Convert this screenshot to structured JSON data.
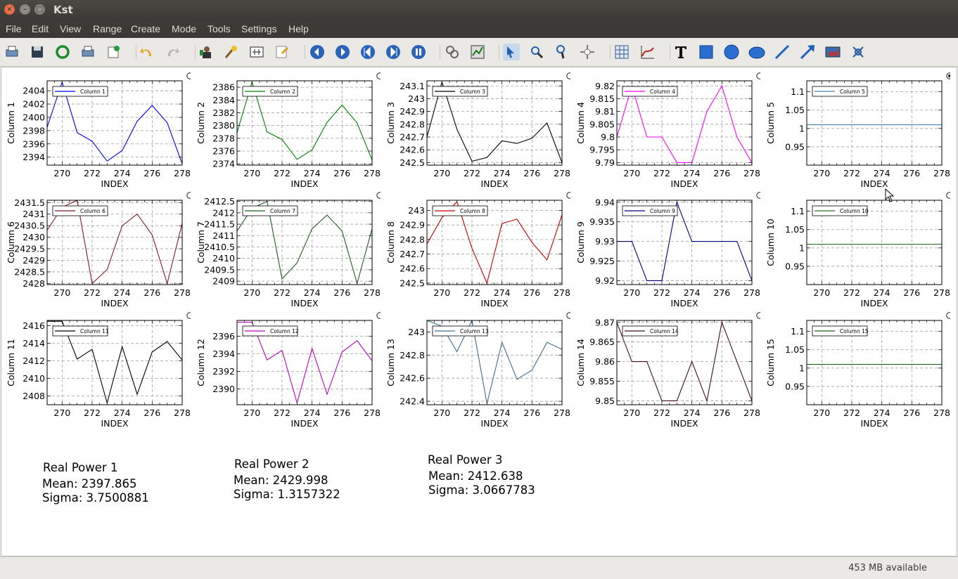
{
  "window": {
    "title": "Kst"
  },
  "menu": [
    "File",
    "Edit",
    "View",
    "Range",
    "Create",
    "Mode",
    "Tools",
    "Settings",
    "Help"
  ],
  "toolbar_icons": [
    "print-icon",
    "save-icon",
    "reload-icon",
    "print-icon",
    "log-icon",
    "undo-icon",
    "redo-icon",
    "data-manager-icon",
    "data-wizard-icon",
    "change-data-file-icon",
    "change-dialog-icon",
    "back-icon",
    "forward-icon",
    "read-from-end-icon",
    "read-to-end-icon",
    "pause-icon",
    "tied-zoom-icon",
    "zoom-xy-icon",
    "zoom-select-icon",
    "zoom-x-icon",
    "zoom-y-icon",
    "layout-icon",
    "table-icon",
    "plot-icon",
    "text-icon",
    "box-icon",
    "circle-icon",
    "ellipse-icon",
    "line-icon",
    "arrow-icon",
    "picture-icon",
    "shared-axis-icon"
  ],
  "status": {
    "memory": "453 MB available"
  },
  "chart_data": [
    {
      "type": "line",
      "ylabel": "Column 1",
      "xlabel": "INDEX",
      "legend": "Column 1",
      "color": "#0000ff",
      "xlim": [
        269,
        278
      ],
      "ylim": [
        2392.8,
        2405.5
      ],
      "yticks": [
        2394,
        2396,
        2398,
        2400,
        2402,
        2404
      ],
      "ytickLabels": [
        "2394",
        "2396",
        "2398",
        "2400",
        "2402",
        "2404"
      ],
      "x": [
        269,
        270,
        271,
        272,
        273,
        274,
        275,
        276,
        277,
        278
      ],
      "y": [
        2398.5,
        2405.3,
        2397.7,
        2396.4,
        2393.4,
        2395.0,
        2399.4,
        2401.8,
        2399.2,
        2393.0
      ]
    },
    {
      "type": "line",
      "ylabel": "Column 2",
      "xlabel": "INDEX",
      "legend": "Column 2",
      "color": "#007f00",
      "xlim": [
        269,
        278
      ],
      "ylim": [
        2373.8,
        2387.0
      ],
      "yticks": [
        2374,
        2376,
        2378,
        2380,
        2382,
        2384,
        2386
      ],
      "ytickLabels": [
        "2374",
        "2376",
        "2378",
        "2380",
        "2382",
        "2384",
        "2386"
      ],
      "x": [
        269,
        270,
        271,
        272,
        273,
        274,
        275,
        276,
        277,
        278
      ],
      "y": [
        2378.9,
        2386.8,
        2379.0,
        2377.8,
        2374.7,
        2376.2,
        2380.5,
        2383.2,
        2380.4,
        2374.6
      ]
    },
    {
      "type": "line",
      "ylabel": "Column 3",
      "xlabel": "INDEX",
      "legend": "Column 3",
      "color": "#000000",
      "xlim": [
        269,
        278
      ],
      "ylim": [
        242.48,
        243.14
      ],
      "yticks": [
        242.5,
        242.6,
        242.7,
        242.8,
        242.9,
        243.0,
        243.1
      ],
      "ytickLabels": [
        "242.5",
        "242.6",
        "242.7",
        "242.8",
        "242.9",
        "243",
        "243.1"
      ],
      "x": [
        269,
        270,
        271,
        272,
        273,
        274,
        275,
        276,
        277,
        278
      ],
      "y": [
        242.7,
        243.13,
        242.76,
        242.51,
        242.54,
        242.67,
        242.65,
        242.69,
        242.81,
        242.5
      ]
    },
    {
      "type": "line",
      "ylabel": "Column 4",
      "xlabel": "INDEX",
      "legend": "Column 4",
      "color": "#ff00ff",
      "xlim": [
        269,
        278
      ],
      "ylim": [
        9.789,
        9.822
      ],
      "yticks": [
        9.79,
        9.795,
        9.8,
        9.805,
        9.81,
        9.815,
        9.82
      ],
      "ytickLabels": [
        "9.79",
        "9.795",
        "9.8",
        "9.805",
        "9.81",
        "9.815",
        "9.82"
      ],
      "x": [
        269,
        270,
        271,
        272,
        273,
        274,
        275,
        276,
        277,
        278
      ],
      "y": [
        9.8,
        9.82,
        9.8,
        9.8,
        9.79,
        9.79,
        9.81,
        9.82,
        9.8,
        9.79
      ]
    },
    {
      "type": "line",
      "ylabel": "Column 5",
      "xlabel": "INDEX",
      "legend": "Column 5",
      "color": "#4682b4",
      "xlim": [
        269,
        278
      ],
      "ylim": [
        0.9,
        1.13
      ],
      "yticks": [
        0.95,
        1.0,
        1.05,
        1.1
      ],
      "ytickLabels": [
        "0.95",
        "1",
        "1.05",
        "1.1"
      ],
      "x": [
        269,
        278
      ],
      "y": [
        1.01,
        1.01
      ]
    },
    {
      "type": "line",
      "ylabel": "Column 6",
      "xlabel": "INDEX",
      "legend": "Column 6",
      "color": "#7f1f1f",
      "xlim": [
        269,
        278
      ],
      "ylim": [
        2427.95,
        2431.6
      ],
      "yticks": [
        2428,
        2428.5,
        2429,
        2429.5,
        2430,
        2430.5,
        2431,
        2431.5
      ],
      "ytickLabels": [
        "2428",
        "2428.5",
        "2429",
        "2429.5",
        "2430",
        "2430.5",
        "2431",
        "2431.5"
      ],
      "x": [
        269,
        270,
        271,
        272,
        273,
        274,
        275,
        276,
        277,
        278
      ],
      "y": [
        2430.3,
        2431.3,
        2431.6,
        2428.0,
        2428.6,
        2430.5,
        2431.0,
        2430.1,
        2428.0,
        2430.6
      ]
    },
    {
      "type": "line",
      "ylabel": "Column 7",
      "xlabel": "INDEX",
      "legend": "Column 7",
      "color": "#1f5f1f",
      "xlim": [
        269,
        278
      ],
      "ylim": [
        2408.85,
        2412.55
      ],
      "yticks": [
        2409,
        2409.5,
        2410,
        2410.5,
        2411,
        2411.5,
        2412,
        2412.5
      ],
      "ytickLabels": [
        "2409",
        "2409.5",
        "2410",
        "2410.5",
        "2411",
        "2411.5",
        "2412",
        "2412.5"
      ],
      "x": [
        269,
        270,
        271,
        272,
        273,
        274,
        275,
        276,
        277,
        278
      ],
      "y": [
        2411.2,
        2412.2,
        2412.5,
        2409.1,
        2409.8,
        2411.3,
        2411.9,
        2411.2,
        2408.9,
        2411.3
      ]
    },
    {
      "type": "line",
      "ylabel": "Column 8",
      "xlabel": "INDEX",
      "legend": "Column 8",
      "color": "#bf0000",
      "xlim": [
        269,
        278
      ],
      "ylim": [
        242.49,
        243.07
      ],
      "yticks": [
        242.5,
        242.6,
        242.7,
        242.8,
        242.9,
        243.0
      ],
      "ytickLabels": [
        "242.5",
        "242.6",
        "242.7",
        "242.8",
        "242.9",
        "243"
      ],
      "x": [
        269,
        270,
        271,
        272,
        273,
        274,
        275,
        276,
        277,
        278
      ],
      "y": [
        242.77,
        242.95,
        243.06,
        242.74,
        242.5,
        242.91,
        242.94,
        242.78,
        242.66,
        242.97
      ]
    },
    {
      "type": "line",
      "ylabel": "Column 9",
      "xlabel": "INDEX",
      "legend": "Column 9",
      "color": "#00007f",
      "xlim": [
        269,
        278
      ],
      "ylim": [
        9.919,
        9.9405
      ],
      "yticks": [
        9.92,
        9.925,
        9.93,
        9.935,
        9.94
      ],
      "ytickLabels": [
        "9.92",
        "9.925",
        "9.93",
        "9.935",
        "9.94"
      ],
      "x": [
        269,
        270,
        271,
        272,
        273,
        274,
        275,
        276,
        277,
        278
      ],
      "y": [
        9.93,
        9.93,
        9.92,
        9.92,
        9.94,
        9.93,
        9.93,
        9.93,
        9.93,
        9.92
      ]
    },
    {
      "type": "line",
      "ylabel": "Column 10",
      "xlabel": "INDEX",
      "legend": "Column 10",
      "color": "#2f6f2f",
      "xlim": [
        269,
        278
      ],
      "ylim": [
        0.9,
        1.13
      ],
      "yticks": [
        0.95,
        1.0,
        1.05,
        1.1
      ],
      "ytickLabels": [
        "0.95",
        "1",
        "1.05",
        "1.1"
      ],
      "x": [
        269,
        278
      ],
      "y": [
        1.01,
        1.01
      ]
    },
    {
      "type": "line",
      "ylabel": "Column 11",
      "xlabel": "INDEX",
      "legend": "Column 11",
      "color": "#000000",
      "xlim": [
        269,
        278
      ],
      "ylim": [
        2407.0,
        2416.6
      ],
      "yticks": [
        2408,
        2410,
        2412,
        2414,
        2416
      ],
      "ytickLabels": [
        "2408",
        "2410",
        "2412",
        "2414",
        "2416"
      ],
      "x": [
        269,
        270,
        271,
        272,
        273,
        274,
        275,
        276,
        277,
        278
      ],
      "y": [
        2416.5,
        2416.5,
        2412.2,
        2413.3,
        2407.2,
        2413.6,
        2408.2,
        2413.0,
        2414.2,
        2412.1
      ]
    },
    {
      "type": "line",
      "ylabel": "Column 12",
      "xlabel": "INDEX",
      "legend": "Column 12",
      "color": "#bf00bf",
      "xlim": [
        269,
        278
      ],
      "ylim": [
        2388.2,
        2397.8
      ],
      "yticks": [
        2390,
        2392,
        2394,
        2396
      ],
      "ytickLabels": [
        "2390",
        "2392",
        "2394",
        "2396"
      ],
      "x": [
        269,
        270,
        271,
        272,
        273,
        274,
        275,
        276,
        277,
        278
      ],
      "y": [
        2397.6,
        2397.6,
        2393.3,
        2394.4,
        2388.4,
        2394.6,
        2389.4,
        2394.2,
        2395.5,
        2393.2
      ]
    },
    {
      "type": "line",
      "ylabel": "Column 13",
      "xlabel": "INDEX",
      "legend": "Column 13",
      "color": "#3f6f8f",
      "xlim": [
        269,
        278
      ],
      "ylim": [
        242.37,
        243.1
      ],
      "yticks": [
        242.4,
        242.6,
        242.8,
        243.0
      ],
      "ytickLabels": [
        "242.4",
        "242.6",
        "242.8",
        "243"
      ],
      "x": [
        269,
        270,
        271,
        272,
        273,
        274,
        275,
        276,
        277,
        278
      ],
      "y": [
        243.1,
        243.05,
        242.83,
        243.1,
        242.38,
        242.91,
        242.59,
        242.67,
        242.91,
        242.85
      ]
    },
    {
      "type": "line",
      "ylabel": "Column 14",
      "xlabel": "INDEX",
      "legend": "Column 14",
      "color": "#3f0f1f",
      "xlim": [
        269,
        278
      ],
      "ylim": [
        9.849,
        9.8705
      ],
      "yticks": [
        9.85,
        9.855,
        9.86,
        9.865,
        9.87
      ],
      "ytickLabels": [
        "9.85",
        "9.855",
        "9.86",
        "9.865",
        "9.87"
      ],
      "x": [
        269,
        270,
        271,
        272,
        273,
        274,
        275,
        276,
        277,
        278
      ],
      "y": [
        9.87,
        9.86,
        9.86,
        9.85,
        9.85,
        9.86,
        9.85,
        9.87,
        9.86,
        9.85
      ]
    },
    {
      "type": "line",
      "ylabel": "Column 15",
      "xlabel": "INDEX",
      "legend": "Column 15",
      "color": "#1f5f1f",
      "xlim": [
        269,
        278
      ],
      "ylim": [
        0.9,
        1.13
      ],
      "yticks": [
        0.95,
        1.0,
        1.05,
        1.1
      ],
      "ytickLabels": [
        "0.95",
        "1",
        "1.05",
        "1.1"
      ],
      "x": [
        269,
        278
      ],
      "y": [
        1.01,
        1.01
      ]
    }
  ],
  "xtickLabels": [
    "270",
    "272",
    "274",
    "276",
    "278"
  ],
  "labels": [
    {
      "title": "Real Power 1",
      "mean": "Mean: 2397.865",
      "sigma": "Sigma: 3.7500881"
    },
    {
      "title": "Real Power 2",
      "mean": "Mean: 2429.998",
      "sigma": "Sigma: 1.3157322"
    },
    {
      "title": "Real Power 3",
      "mean": "Mean: 2412.638",
      "sigma": "Sigma: 3.0667783"
    }
  ]
}
